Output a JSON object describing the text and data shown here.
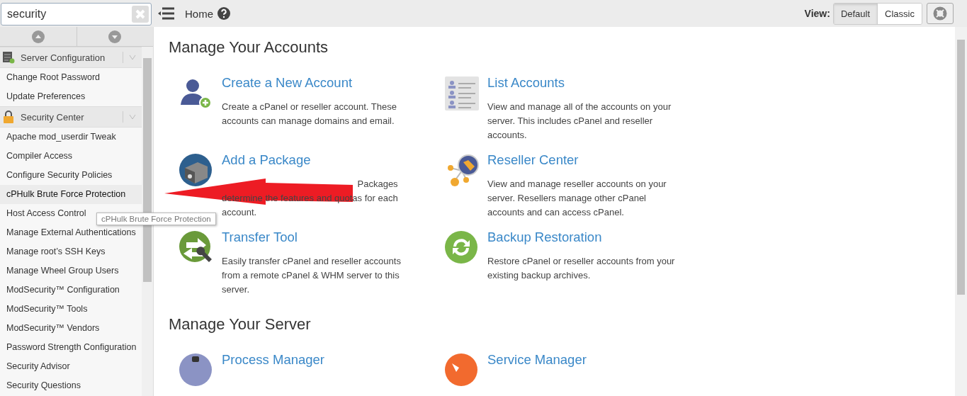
{
  "search": {
    "value": "security"
  },
  "topbar": {
    "breadcrumb": "Home",
    "view_label": "View:",
    "view_options": [
      {
        "label": "Default",
        "selected": true
      },
      {
        "label": "Classic",
        "selected": false
      }
    ]
  },
  "sidebar": {
    "sections": [
      {
        "title": "Server Configuration",
        "items": [
          {
            "label": "Change Root Password",
            "selected": false
          },
          {
            "label": "Update Preferences",
            "selected": false
          }
        ]
      },
      {
        "title": "Security Center",
        "items": [
          {
            "label": "Apache mod_userdir Tweak",
            "selected": false
          },
          {
            "label": "Compiler Access",
            "selected": false
          },
          {
            "label": "Configure Security Policies",
            "selected": false
          },
          {
            "label": "cPHulk Brute Force Protection",
            "selected": true
          },
          {
            "label": "Host Access Control",
            "selected": false
          },
          {
            "label": "Manage External Authentications",
            "selected": false
          },
          {
            "label": "Manage root’s SSH Keys",
            "selected": false
          },
          {
            "label": "Manage Wheel Group Users",
            "selected": false
          },
          {
            "label": "ModSecurity™ Configuration",
            "selected": false
          },
          {
            "label": "ModSecurity™ Tools",
            "selected": false
          },
          {
            "label": "ModSecurity™ Vendors",
            "selected": false
          },
          {
            "label": "Password Strength Configuration",
            "selected": false
          },
          {
            "label": "Security Advisor",
            "selected": false
          },
          {
            "label": "Security Questions",
            "selected": false
          }
        ]
      }
    ]
  },
  "tooltip": "cPHulk Brute Force Protection",
  "groups": [
    {
      "title": "Manage Your Accounts",
      "cards": [
        {
          "title": "Create a New Account",
          "description": [
            "Create a cPanel or reseller account. These",
            "accounts can manage domains and email."
          ]
        },
        {
          "title": "List Accounts",
          "description": [
            "View and manage all of the accounts on your",
            "server. This includes cPanel and reseller",
            "accounts."
          ]
        },
        {
          "title": "Add a Package",
          "partly_covered": true,
          "description": [
            "Packages",
            "determine the features and quotas for each",
            "account."
          ]
        },
        {
          "title": "Reseller Center",
          "description": [
            "View and manage reseller accounts on your",
            "server. Resellers manage other cPanel",
            "accounts and can access cPanel."
          ]
        },
        {
          "title": "Transfer Tool",
          "description": [
            "Easily transfer cPanel and reseller accounts",
            "from a remote cPanel & WHM server to this",
            "server."
          ]
        },
        {
          "title": "Backup Restoration",
          "description": [
            "Restore cPanel or reseller accounts from your",
            "existing backup archives."
          ]
        }
      ]
    },
    {
      "title": "Manage Your Server",
      "cards": [
        {
          "title": "Process Manager"
        },
        {
          "title": "Service Manager"
        }
      ]
    }
  ]
}
